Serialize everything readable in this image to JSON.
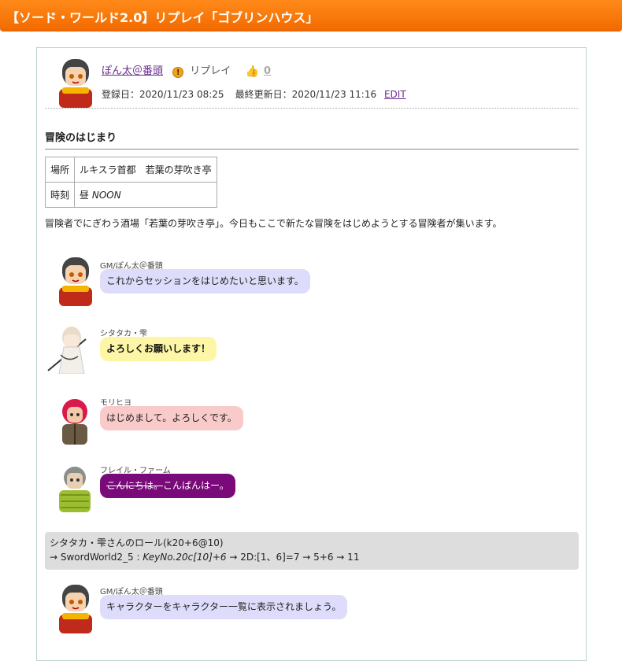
{
  "page": {
    "title": "【ソード・ワールド2.0】リプレイ「ゴブリンハウス」"
  },
  "meta": {
    "author": "ぽん太＠番頭",
    "warn_glyph": "!",
    "kind": "リプレイ",
    "likes": "0",
    "registered_label": "登録日：2020/11/23 08:25",
    "updated_label": "最終更新日：2020/11/23 11:16",
    "edit_label": "EDIT"
  },
  "section": {
    "title": "冒険のはじまり",
    "info": [
      {
        "key": "場所",
        "value": "ルキスラ首都　若葉の芽吹き亭"
      },
      {
        "key": "時刻",
        "value_main": "昼 ",
        "value_em": "NOON"
      }
    ],
    "description": "冒険者でにぎわう酒場「若葉の芽吹き亭」。今日もここで新たな冒険をはじめようとする冒険者が集います。"
  },
  "messages": [
    {
      "speaker": "GM/ぽん太＠番頭",
      "text": "これからセッションをはじめたいと思います。"
    },
    {
      "speaker": "シタタカ・雫",
      "text": "よろしくお願いします！"
    },
    {
      "speaker": "モリヒヨ",
      "text": "はじめまして。よろしくです。"
    },
    {
      "speaker": "フレイル・ファーム",
      "text_strike": "こんにちは。",
      "text": "こんばんはー。"
    }
  ],
  "roll": {
    "line1": "シタタカ・雫さんのロール(k20+6@10)",
    "line2_prefix": "→ SwordWorld2_5 : ",
    "line2_em": "KeyNo.20c[10]+6",
    "line2_suffix": " → 2D:[1、6]=7 → 5+6 → 11"
  },
  "message_after_roll": {
    "speaker": "GM/ぽん太＠番頭",
    "text": "キャラクターをキャラクター一覧に表示されましょう。"
  },
  "colors": {
    "header_orange": "#f26a00",
    "gm_bubble": "#dddcfa",
    "shitataka_bubble": "#fdf6a7",
    "morihiyo_bubble": "#f9caca",
    "furairu_bubble": "#7a0a7a"
  }
}
